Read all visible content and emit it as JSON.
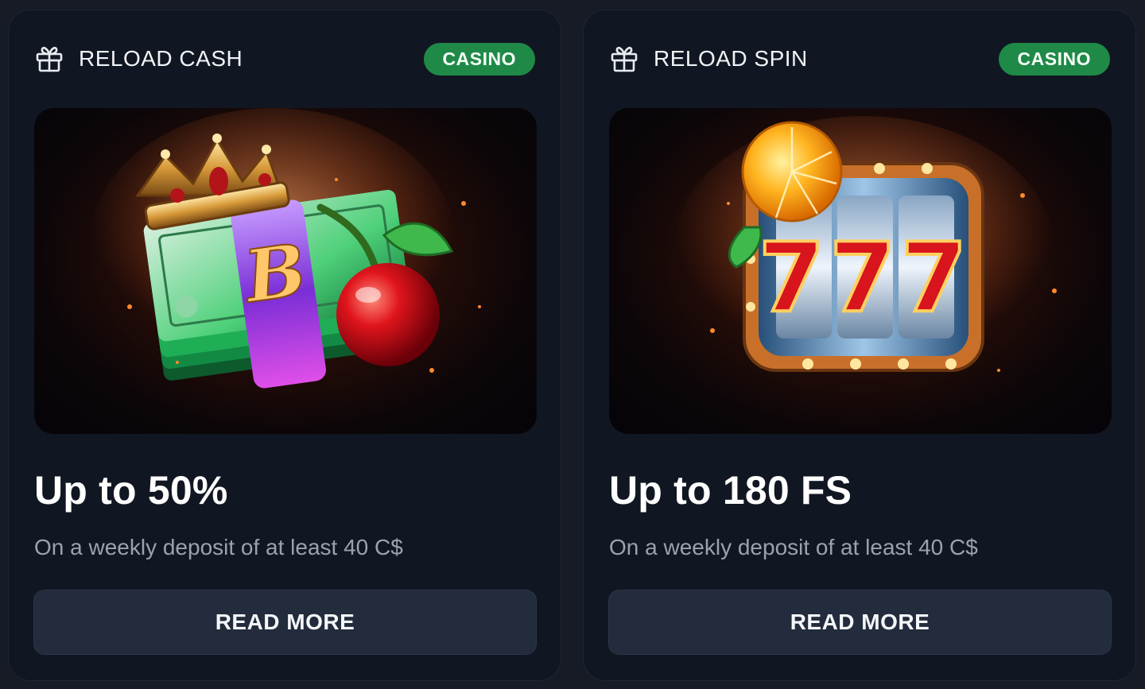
{
  "cards": [
    {
      "title": "RELOAD CASH",
      "badge": "CASINO",
      "headline": "Up to 50%",
      "description": "On a weekly deposit of at least 40 C$",
      "button": "READ MORE",
      "illustration_letter": "B"
    },
    {
      "title": "RELOAD SPIN",
      "badge": "CASINO",
      "headline": "Up to 180 FS",
      "description": "On a weekly deposit of at least 40 C$",
      "button": "READ MORE",
      "illustration_text": "777"
    }
  ],
  "colors": {
    "background": "#161b26",
    "card": "#111722",
    "badge": "#1f8a47",
    "button": "#232c3c",
    "description": "#9aa2b0"
  },
  "icons": [
    "gift-icon"
  ]
}
